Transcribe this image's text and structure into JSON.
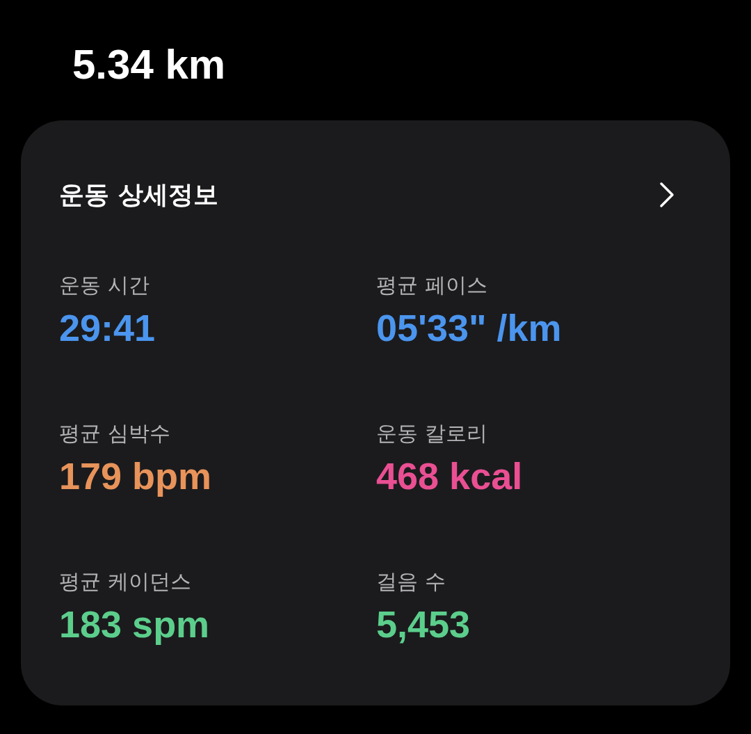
{
  "distance": "5.34 km",
  "card": {
    "title": "운동 상세정보",
    "stats": [
      {
        "label": "운동 시간",
        "value": "29:41",
        "color": "#4b95ee"
      },
      {
        "label": "평균 페이스",
        "value": "05'33\" /km",
        "color": "#4b95ee"
      },
      {
        "label": "평균 심박수",
        "value": "179 bpm",
        "color": "#e8935a"
      },
      {
        "label": "운동 칼로리",
        "value": "468 kcal",
        "color": "#ea4f93"
      },
      {
        "label": "평균 케이던스",
        "value": "183 spm",
        "color": "#5cce8c"
      },
      {
        "label": "걸음 수",
        "value": "5,453",
        "color": "#5cce8c"
      }
    ]
  }
}
